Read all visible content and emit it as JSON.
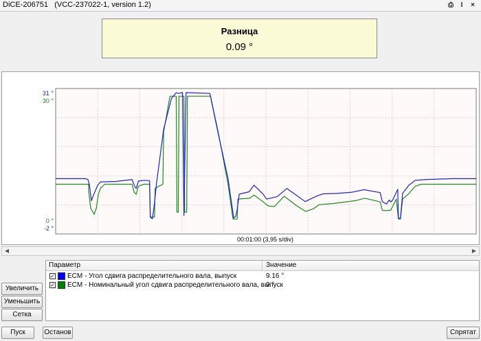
{
  "window": {
    "app": "DiCE-206751",
    "subtitle": "(VCC-237022-1, version 1.2)",
    "tools": [
      "printer-icon",
      "info-icon",
      "close-icon"
    ],
    "tool_glyphs": [
      "⎙",
      "I",
      "×"
    ]
  },
  "difference": {
    "label": "Разница",
    "value": "0.09 °"
  },
  "chart": {
    "y_tick_blue_top": "31 °",
    "y_tick_green_top": "30 °",
    "y_tick_green_bottom": "0 °",
    "y_tick_blue_bottom": "-2 °",
    "x_label": "00:01:00 (3,95 s/div)",
    "colors": {
      "blue": "#1f1fd8",
      "green": "#1b8a1b"
    }
  },
  "chart_data": {
    "type": "line",
    "xlabel": "00:01:00 (3,95 s/div)",
    "x_range": [
      0,
      60
    ],
    "series": [
      {
        "name": "ECM - Угол сдвига распределительного вала, выпуск",
        "color": "#1f1fd8",
        "axis_range": [
          -2,
          31
        ],
        "points": [
          [
            0.0,
            10.0
          ],
          [
            2.3,
            10.0
          ],
          [
            4.3,
            10.0
          ],
          [
            4.6,
            9.8
          ],
          [
            4.8,
            8.6
          ],
          [
            5.1,
            4.6
          ],
          [
            5.4,
            6.0
          ],
          [
            6.0,
            8.4
          ],
          [
            6.4,
            9.2
          ],
          [
            8.6,
            9.3
          ],
          [
            10.9,
            9.8
          ],
          [
            11.3,
            8.0
          ],
          [
            11.5,
            7.6
          ],
          [
            11.8,
            9.4
          ],
          [
            12.7,
            9.6
          ],
          [
            13.4,
            9.5
          ],
          [
            13.5,
            0.6
          ],
          [
            13.8,
            0.2
          ],
          [
            14.1,
            4.0
          ],
          [
            14.4,
            9.0
          ],
          [
            15.4,
            22.0
          ],
          [
            16.5,
            29.5
          ],
          [
            17.2,
            31.0
          ],
          [
            17.5,
            30.8
          ],
          [
            18.1,
            31.0
          ],
          [
            18.3,
            1.0
          ],
          [
            18.6,
            31.0
          ],
          [
            22.0,
            30.8
          ],
          [
            23.2,
            21.0
          ],
          [
            24.6,
            10.0
          ],
          [
            25.4,
            0.4
          ],
          [
            25.7,
            0.8
          ],
          [
            25.9,
            2.5
          ],
          [
            26.2,
            6.2
          ],
          [
            27.6,
            6.8
          ],
          [
            28.3,
            8.4
          ],
          [
            29.6,
            6.2
          ],
          [
            30.1,
            5.0
          ],
          [
            31.6,
            5.6
          ],
          [
            33.0,
            7.6
          ],
          [
            34.3,
            6.0
          ],
          [
            35.6,
            4.4
          ],
          [
            37.3,
            5.8
          ],
          [
            38.2,
            6.3
          ],
          [
            40.2,
            6.4
          ],
          [
            42.3,
            6.7
          ],
          [
            44.0,
            7.3
          ],
          [
            46.3,
            6.6
          ],
          [
            46.6,
            4.4
          ],
          [
            47.2,
            3.8
          ],
          [
            47.6,
            4.8
          ],
          [
            47.8,
            4.3
          ],
          [
            48.1,
            4.8
          ],
          [
            48.8,
            7.4
          ],
          [
            48.9,
            0.4
          ],
          [
            49.2,
            0.3
          ],
          [
            49.5,
            6.4
          ],
          [
            50.4,
            8.4
          ],
          [
            51.3,
            9.6
          ],
          [
            52.9,
            9.8
          ],
          [
            56.6,
            10.0
          ],
          [
            60.0,
            10.0
          ]
        ]
      },
      {
        "name": "ECM - Номинальный угол сдвига распределительного вала, выпуск",
        "color": "#1b8a1b",
        "axis_range": [
          0,
          30
        ],
        "points": [
          [
            0.0,
            9.0
          ],
          [
            4.3,
            9.0
          ],
          [
            4.7,
            9.0
          ],
          [
            4.7,
            7.5
          ],
          [
            5.0,
            3.0
          ],
          [
            5.5,
            1.5
          ],
          [
            5.8,
            3.0
          ],
          [
            6.1,
            6.5
          ],
          [
            6.4,
            8.0
          ],
          [
            7.0,
            9.0
          ],
          [
            10.9,
            9.0
          ],
          [
            11.2,
            7.0
          ],
          [
            11.5,
            6.5
          ],
          [
            11.8,
            8.5
          ],
          [
            12.6,
            9.0
          ],
          [
            13.4,
            9.0
          ],
          [
            13.5,
            0.8
          ],
          [
            14.1,
            0.8
          ],
          [
            14.2,
            8.0
          ],
          [
            15.3,
            9.0
          ],
          [
            15.4,
            22.0
          ],
          [
            16.3,
            31.0
          ],
          [
            17.2,
            31.0
          ],
          [
            17.3,
            2.0
          ],
          [
            17.5,
            2.0
          ],
          [
            17.6,
            31.0
          ],
          [
            18.3,
            31.0
          ],
          [
            18.4,
            2.0
          ],
          [
            18.7,
            2.0
          ],
          [
            18.8,
            31.0
          ],
          [
            22.1,
            31.0
          ],
          [
            23.2,
            22.0
          ],
          [
            24.6,
            9.0
          ],
          [
            25.3,
            0.3
          ],
          [
            25.9,
            0.3
          ],
          [
            26.0,
            5.3
          ],
          [
            27.7,
            5.5
          ],
          [
            28.3,
            6.3
          ],
          [
            29.6,
            4.6
          ],
          [
            30.3,
            3.6
          ],
          [
            31.2,
            3.4
          ],
          [
            32.6,
            6.0
          ],
          [
            34.4,
            3.6
          ],
          [
            35.7,
            2.2
          ],
          [
            36.8,
            2.9
          ],
          [
            37.6,
            3.9
          ],
          [
            39.7,
            4.2
          ],
          [
            42.8,
            4.9
          ],
          [
            44.1,
            5.5
          ],
          [
            46.3,
            4.6
          ],
          [
            46.6,
            2.5
          ],
          [
            47.1,
            2.4
          ],
          [
            47.8,
            2.5
          ],
          [
            48.6,
            5.3
          ],
          [
            48.9,
            0.3
          ],
          [
            49.2,
            0.3
          ],
          [
            49.5,
            5.3
          ],
          [
            50.3,
            6.5
          ],
          [
            51.3,
            8.5
          ],
          [
            52.2,
            9.0
          ],
          [
            60.0,
            9.0
          ]
        ]
      }
    ],
    "grid": true
  },
  "table": {
    "headers": [
      "Параметр",
      "Значение"
    ],
    "rows": [
      {
        "checked": true,
        "color": "#0000ff",
        "name": "ECM - Угол сдвига распределительного вала, выпуск",
        "value": "9.16 °"
      },
      {
        "checked": true,
        "color": "#008000",
        "name": "ECM - Номинальный угол сдвига распределительного вала, выпуск",
        "value": "9 °"
      }
    ]
  },
  "buttons": {
    "zoom_in": "Увеличить",
    "zoom_out": "Уменьшить",
    "grid": "Сетка",
    "start": "Пуск",
    "stop": "Останов",
    "hide": "Спрятат"
  },
  "scrollbar": {
    "left": "◀",
    "right": "▶"
  }
}
